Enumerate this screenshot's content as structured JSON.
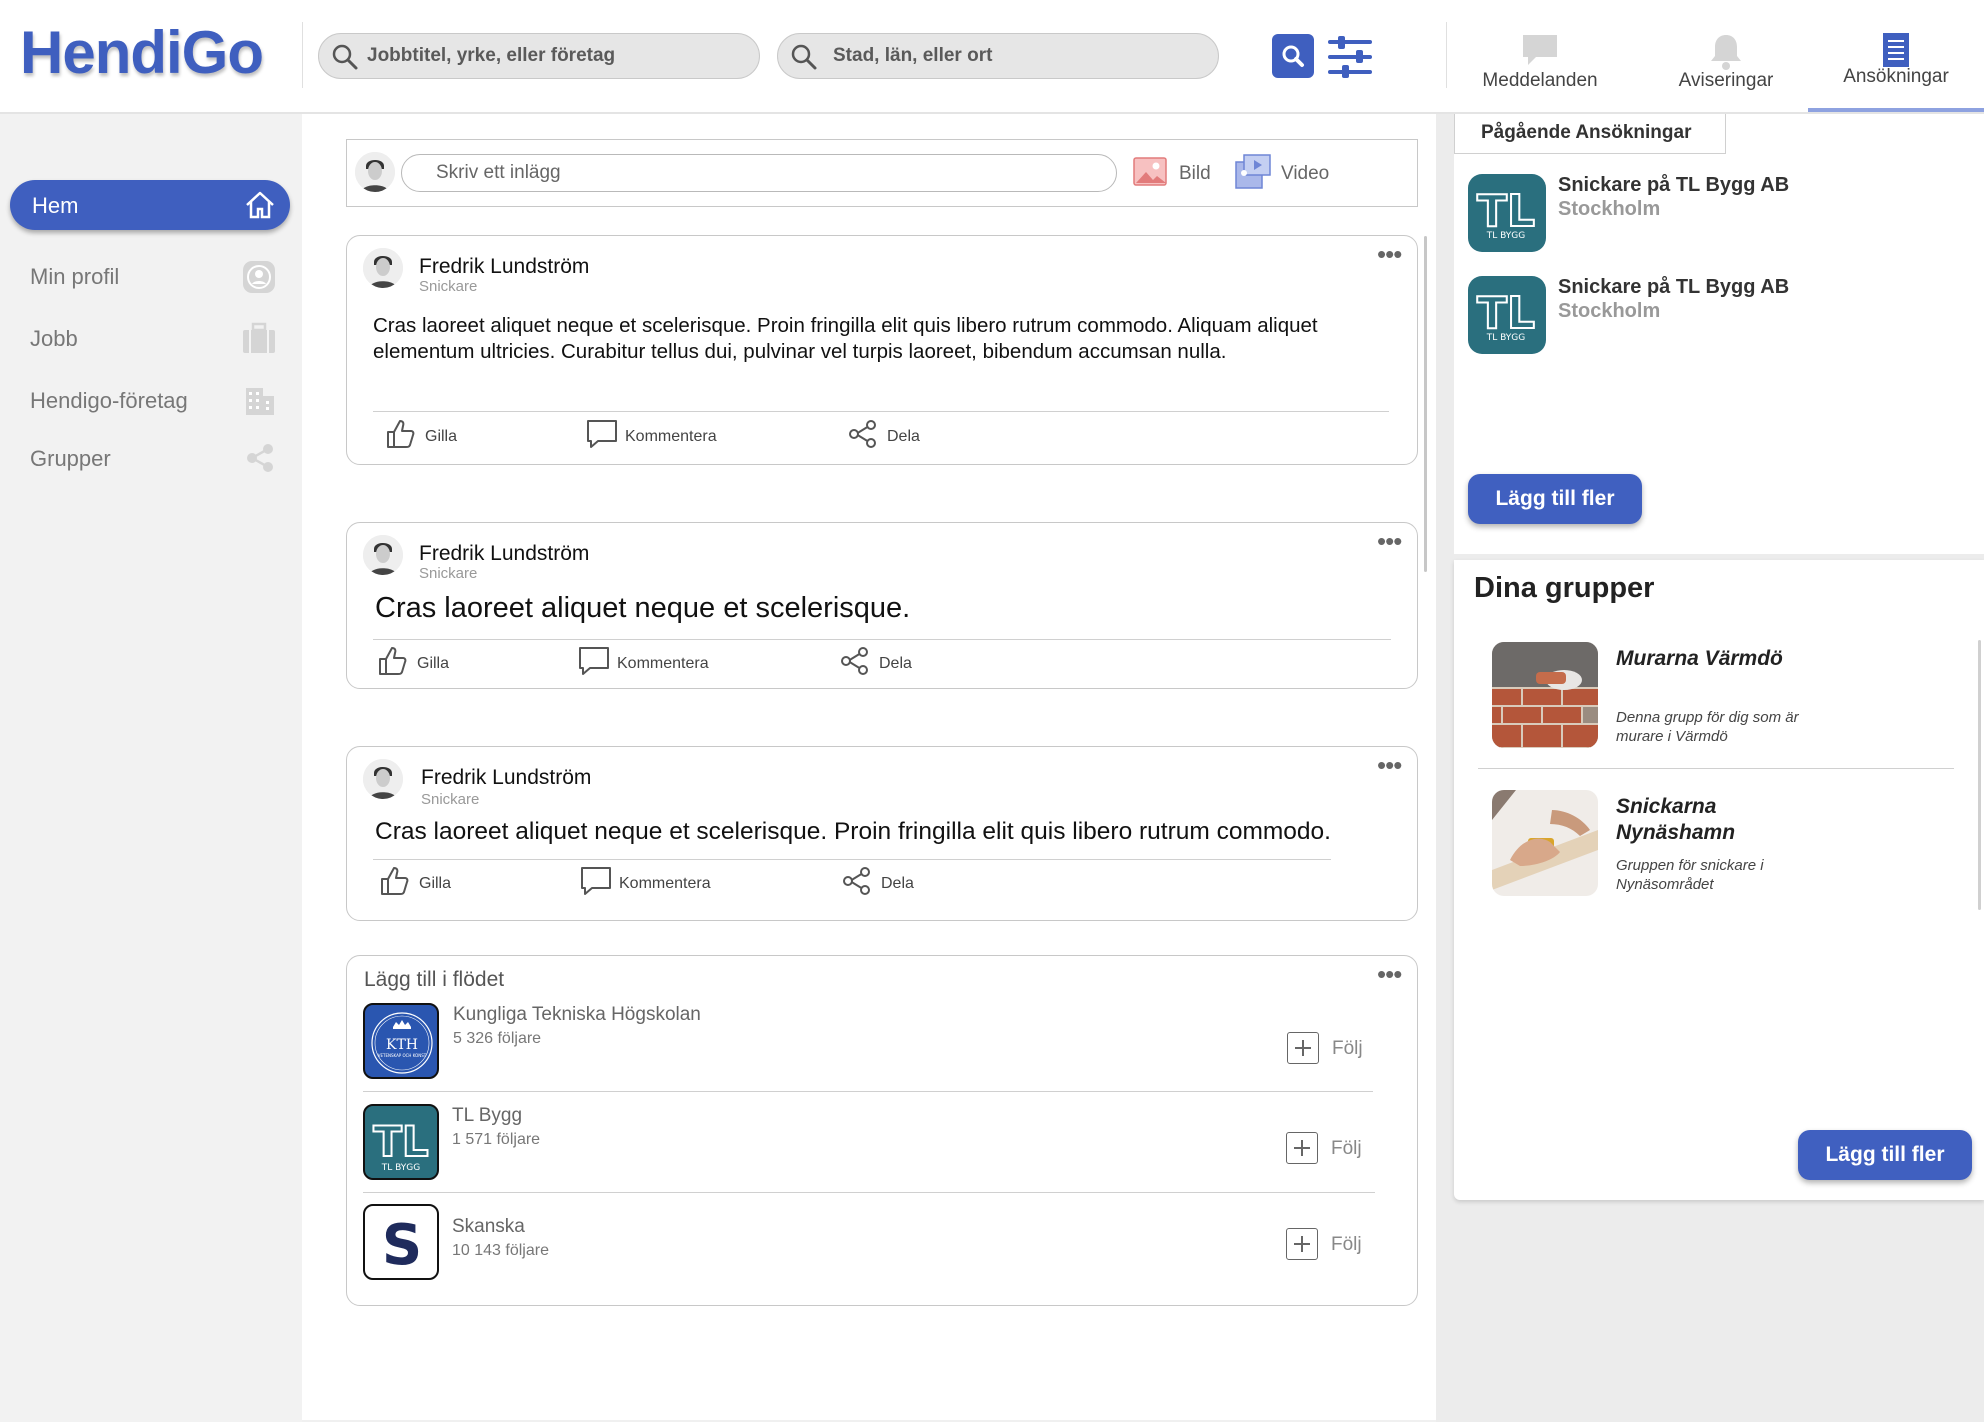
{
  "header": {
    "logo": "HendiGo",
    "search_job_placeholder": "Jobbtitel, yrke, eller företag",
    "search_location_placeholder": "Stad, län, eller ort",
    "nav": [
      {
        "label": "Meddelanden",
        "icon": "chat-bubble-icon"
      },
      {
        "label": "Aviseringar",
        "icon": "bell-icon"
      },
      {
        "label": "Ansökningar",
        "icon": "document-icon",
        "active": true
      }
    ]
  },
  "sidebar": {
    "items": [
      {
        "label": "Hem",
        "icon": "home-icon",
        "active": true
      },
      {
        "label": "Min profil",
        "icon": "profile-icon"
      },
      {
        "label": "Jobb",
        "icon": "briefcase-icon"
      },
      {
        "label": "Hendigo-företag",
        "icon": "building-icon"
      },
      {
        "label": "Grupper",
        "icon": "share-icon"
      }
    ]
  },
  "composer": {
    "placeholder": "Skriv ett inlägg",
    "image_label": "Bild",
    "video_label": "Video"
  },
  "posts": [
    {
      "author": "Fredrik Lundström",
      "role": "Snickare",
      "text": "Cras laoreet aliquet neque et scelerisque. Proin fringilla elit quis libero rutrum commodo. Aliquam aliquet elementum ultricies. Curabitur tellus dui, pulvinar vel turpis laoreet, bibendum accumsan nulla."
    },
    {
      "author": "Fredrik Lundström",
      "role": "Snickare",
      "text": "Cras laoreet aliquet neque et scelerisque."
    },
    {
      "author": "Fredrik Lundström",
      "role": "Snickare",
      "text": "Cras laoreet aliquet neque et scelerisque. Proin fringilla elit quis libero rutrum commodo."
    }
  ],
  "actions": {
    "like": "Gilla",
    "comment": "Kommentera",
    "share": "Dela"
  },
  "suggestions": {
    "title": "Lägg till i flödet",
    "follow_label": "Följ",
    "items": [
      {
        "name": "Kungliga Tekniska Högskolan",
        "followers": "5 326 följare",
        "logo_text": "KTH",
        "logo_sub": "VETENSKAP OCH KONST"
      },
      {
        "name": "TL Bygg",
        "followers": "1 571 följare",
        "logo_text": "TL",
        "logo_sub": "TL BYGG"
      },
      {
        "name": "Skanska",
        "followers": "10 143 följare",
        "logo_text": "S"
      }
    ]
  },
  "applications": {
    "tab_label": "Pågående Ansökningar",
    "items": [
      {
        "title": "Snickare på TL Bygg AB",
        "location": "Stockholm",
        "logo_sub": "TL BYGG"
      },
      {
        "title": "Snickare på TL Bygg AB",
        "location": "Stockholm",
        "logo_sub": "TL BYGG"
      }
    ],
    "add_more": "Lägg till fler"
  },
  "groups": {
    "title": "Dina grupper",
    "items": [
      {
        "name": "Murarna Värmdö",
        "description": "Denna grupp för dig som är murare i Värmdö"
      },
      {
        "name": "Snickarna Nynäshamn",
        "description": "Gruppen för snickare i Nynäsområdet"
      }
    ],
    "add_more": "Lägg till fler"
  },
  "colors": {
    "brand": "#3f5fbf",
    "tl_teal": "#2a6f7e"
  }
}
